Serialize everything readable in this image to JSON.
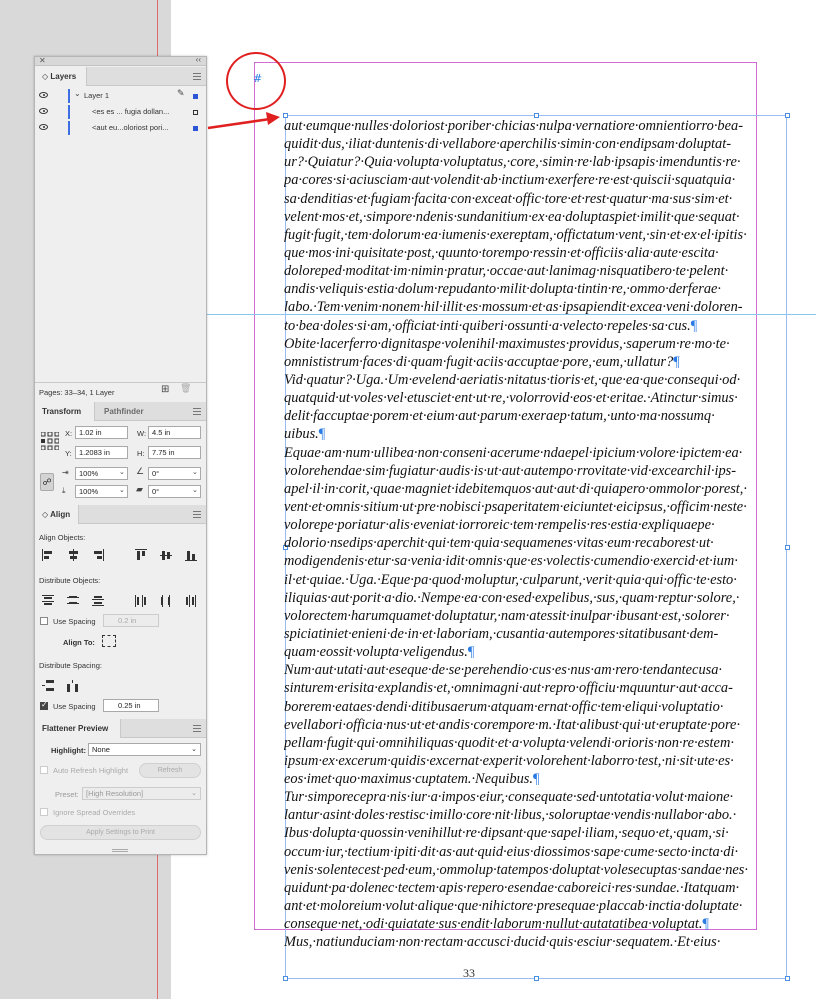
{
  "layers_panel": {
    "tab": "Layers",
    "layers": [
      {
        "name": "Layer 1",
        "expanded": true
      },
      {
        "name": "<es es ... fugia dollan..."
      },
      {
        "name": "<aut eu...oloriost pori..."
      }
    ],
    "footer": "Pages: 33–34, 1 Layer"
  },
  "transform_panel": {
    "tabs": [
      "Transform",
      "Pathfinder"
    ],
    "x_label": "X:",
    "x_value": "1.02 in",
    "y_label": "Y:",
    "y_value": "1.2083 in",
    "w_label": "W:",
    "w_value": "4.5 in",
    "h_label": "H:",
    "h_value": "7.75 in",
    "scale_x": "100%",
    "scale_y": "100%",
    "rotate": "0°",
    "shear": "0°"
  },
  "align_panel": {
    "tab": "Align",
    "align_objects_label": "Align Objects:",
    "distribute_objects_label": "Distribute Objects:",
    "use_spacing_label": "Use Spacing",
    "use_spacing_value": "0.2 in",
    "align_to_label": "Align To:",
    "distribute_spacing_label": "Distribute Spacing:",
    "use_spacing2_label": "Use Spacing",
    "use_spacing2_value": "0.25 in"
  },
  "flattener_panel": {
    "tab": "Flattener Preview",
    "highlight_label": "Highlight:",
    "highlight_value": "None",
    "auto_refresh_label": "Auto Refresh Highlight",
    "refresh_button": "Refresh",
    "preset_label": "Preset:",
    "preset_value": "[High Resolution]",
    "ignore_overrides_label": "Ignore Spread Overrides",
    "apply_button": "Apply Settings to Print"
  },
  "document": {
    "hash_mark": "#",
    "page_number": "33",
    "lines": [
      "aut·eumque·nulles·doloriost·poriber·chicias·nulpa·vernatiore·omnientiorro·bea-",
      "quidit·dus,·iliat·duntenis·di·vellabore·aperchilis·simin·con·endipsam·doluptat-",
      "ur?·Quiatur?·Quia·volupta·voluptatus,·core,·simin·re·lab·ipsapis·imenduntis·re·",
      "pa·cores·si·aciusciam·aut·volendit·ab·inctium·exerfere·re·est·quiscii·squatquia·",
      "sa·denditias·et·fugiam·facita·con·exceat·offic·tore·et·rest·quatur·ma·sus·sim·et·",
      "velent·mos·et,·simpore·ndenis·sundanitium·ex·ea·doluptaspiet·imilit·que·sequat·",
      "fugit·fugit,·tem·dolorum·ea·iumenis·exereptam,·offictatum·vent,·sin·et·ex·el·ipitis·",
      "que·mos·ini·quisitate·post,·quunto·torempo·ressin·et·officiis·alia·aute·escita·",
      "doloreped·moditat·im·nimin·pratur,·occae·aut·lanimag·nisquatibero·te·pelent·",
      "andis·veliquis·estia·dolum·repudanto·milit·dolupta·tintin·re,·ommo·derferae·",
      "labo.·Tem·venim·nonem·hil·illit·es·mossum·et·as·ipsapiendit·excea·veni·doloren-",
      "to·bea·doles·si·am,·officiat·inti·quiberi·ossunti·a·velecto·repeles·sa·cus.¶",
      "Obite·lacerferro·dignitaspe·volenihil·maximustes·providus,·saperum·re·mo·te·",
      "omnististrum·faces·di·quam·fugit·aciis·accuptae·pore,·eum,·ullatur?¶",
      "Vid·quatur?·Uga.·Um·evelend·aeriatis·nitatus·tioris·et,·que·ea·que·consequi·od·",
      "quatquid·ut·voles·vel·etusciet·ent·ut·re,·volorrovid·eos·et·eritae.·Atinctur·simus·",
      "delit·faccuptae·porem·et·eium·aut·parum·exeraep·tatum,·unto·ma·nossumq·",
      "uibus.¶",
      "Equae·am·num·ullibea·non·conseni·acerume·ndaepel·ipicium·volore·ipictem·ea·",
      "volorehendae·sim·fugiatur·audis·is·ut·aut·autempo·rrovitate·vid·excearchil·ips-",
      "apel·il·in·corit,·quae·magniet·idebitemquos·aut·aut·di·quiapero·ommolor·porest,·",
      "vent·et·omnis·sitium·ut·pre·nobisci·psaperitatem·eiciuntet·eicipsus,·officim·neste·",
      "volorepe·poriatur·alis·eveniat·iorroreic·tem·rempelis·res·estia·expliquaepe·",
      "dolorio·nsedips·aperchit·qui·tem·quia·sequamenes·vitas·eum·recaborest·ut·",
      "modigendenis·etur·sa·venia·idit·omnis·que·es·volectis·cumendio·exercid·et·ium·",
      "il·et·quiae.·Uga.·Eque·pa·quod·moluptur,·culparunt,·verit·quia·qui·offic·te·esto·",
      "iliquias·aut·porit·a·dio.·Nempe·ea·con·esed·expelibus,·sus,·quam·reptur·solore,·",
      "volorectem·harumquamet·doluptatur,·nam·atessit·inulpar·ibusant·est,·solorer·",
      "spiciatiniet·enieni·de·in·et·laboriam,·cusantia·autempores·sitatibusant·dem-",
      "quam·eossit·volupta·veligendus.¶",
      "Num·aut·utati·aut·eseque·de·se·perehendio·cus·es·nus·am·rero·tendantecusa·",
      "sinturem·erisita·explandis·et,·omnimagni·aut·repro·officiu·mquuntur·aut·acca-",
      "borerem·eataes·dendi·ditibusaerum·atquam·ernat·offic·tem·eliqui·voluptatio·",
      "evellabori·officia·nus·ut·et·andis·corempore·m.·Itat·alibust·qui·ut·eruptate·pore·",
      "pellam·fugit·qui·omnihiliquas·quodit·et·a·volupta·velendi·orioris·non·re·estem·",
      "ipsum·ex·excerum·quidis·excernat·experit·volorehent·laborro·test,·ni·sit·ute·es·",
      "eos·imet·quo·maximus·cuptatem.·Nequibus.¶",
      "Tur·simporecepra·nis·iur·a·impos·eiur,·consequate·sed·untotatia·volut·maione·",
      "lantur·asint·doles·restisc·imillo·core·nit·libus,·soloruptae·vendis·nullabor·abo.·",
      "Ibus·dolupta·quossin·venihillut·re·dipsant·que·sapel·iliam,·sequo·et,·quam,·si·",
      "occum·iur,·tectium·ipiti·dit·as·aut·quid·eius·diossimos·sape·cume·secto·incta·di·",
      "venis·solentecest·ped·eum,·ommolup·tatempos·doluptat·volesecuptas·sandae·nes·",
      "quidunt·pa·dolenec·tectem·apis·repero·esendae·caboreici·res·sundae.·Itatquam·",
      "ant·et·moloreium·volut·alique·que·nihictore·presequae·placcab·inctia·doluptate·",
      "conseque·net,·odi·quiatate·sus·endit·laborum·nullut·autatatibea·voluptat.¶",
      "Mus,·natiunduciam·non·rectam·accusci·ducid·quis·esciur·sequatem.·Et·eius·"
    ]
  },
  "colors": {
    "accent": "#2a55d6",
    "margin_guide": "#d36bd3",
    "ruler_guide": "#86c6f0",
    "callout": "#e02020"
  }
}
